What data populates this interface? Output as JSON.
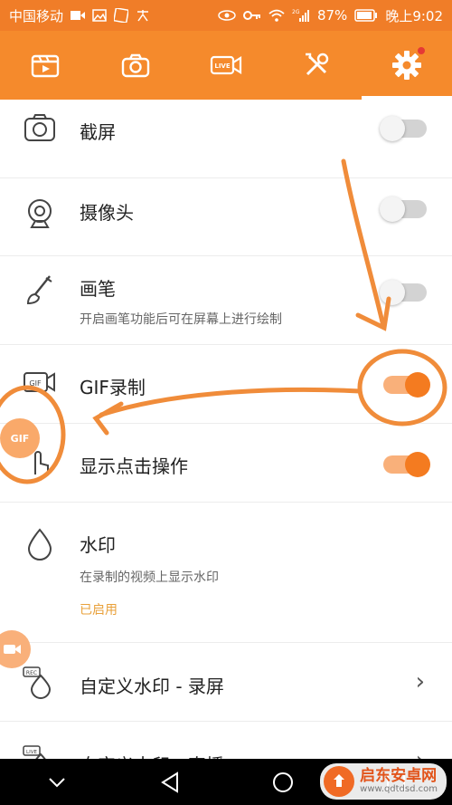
{
  "statusbar": {
    "carrier": "中国移动",
    "battery": "87%",
    "time": "晚上9:02",
    "signal_label": "2G"
  },
  "toolbar": {
    "tabs": [
      {
        "icon": "video-list-icon"
      },
      {
        "icon": "camera-icon"
      },
      {
        "icon": "live-icon",
        "label": "LIVE"
      },
      {
        "icon": "tools-icon"
      },
      {
        "icon": "settings-gear-icon",
        "selected": true
      }
    ]
  },
  "settings": {
    "screenshot": {
      "title": "截屏",
      "enabled": false
    },
    "camera": {
      "title": "摄像头",
      "enabled": false
    },
    "brush": {
      "title": "画笔",
      "desc": "开启画笔功能后可在屏幕上进行绘制",
      "enabled": false
    },
    "gif": {
      "title": "GIF录制",
      "enabled": true,
      "icon_label": "GIF"
    },
    "show_touches": {
      "title": "显示点击操作",
      "enabled": true
    },
    "watermark": {
      "title": "水印",
      "desc": "在录制的视频上显示水印",
      "status": "已启用"
    },
    "custom_wm_rec": {
      "title": "自定义水印 - 录屏",
      "icon_label": "REC"
    },
    "custom_wm_live": {
      "title": "自定义水印 - 直播",
      "icon_label": "LIVE"
    }
  },
  "floating": {
    "gif_label": "GIF"
  },
  "site_watermark": {
    "name": "启东安卓网",
    "url": "www.qdtdsd.com"
  },
  "colors": {
    "accent": "#f58a2c",
    "toggle_on": "#f47b20",
    "status": "#e9a13b"
  }
}
